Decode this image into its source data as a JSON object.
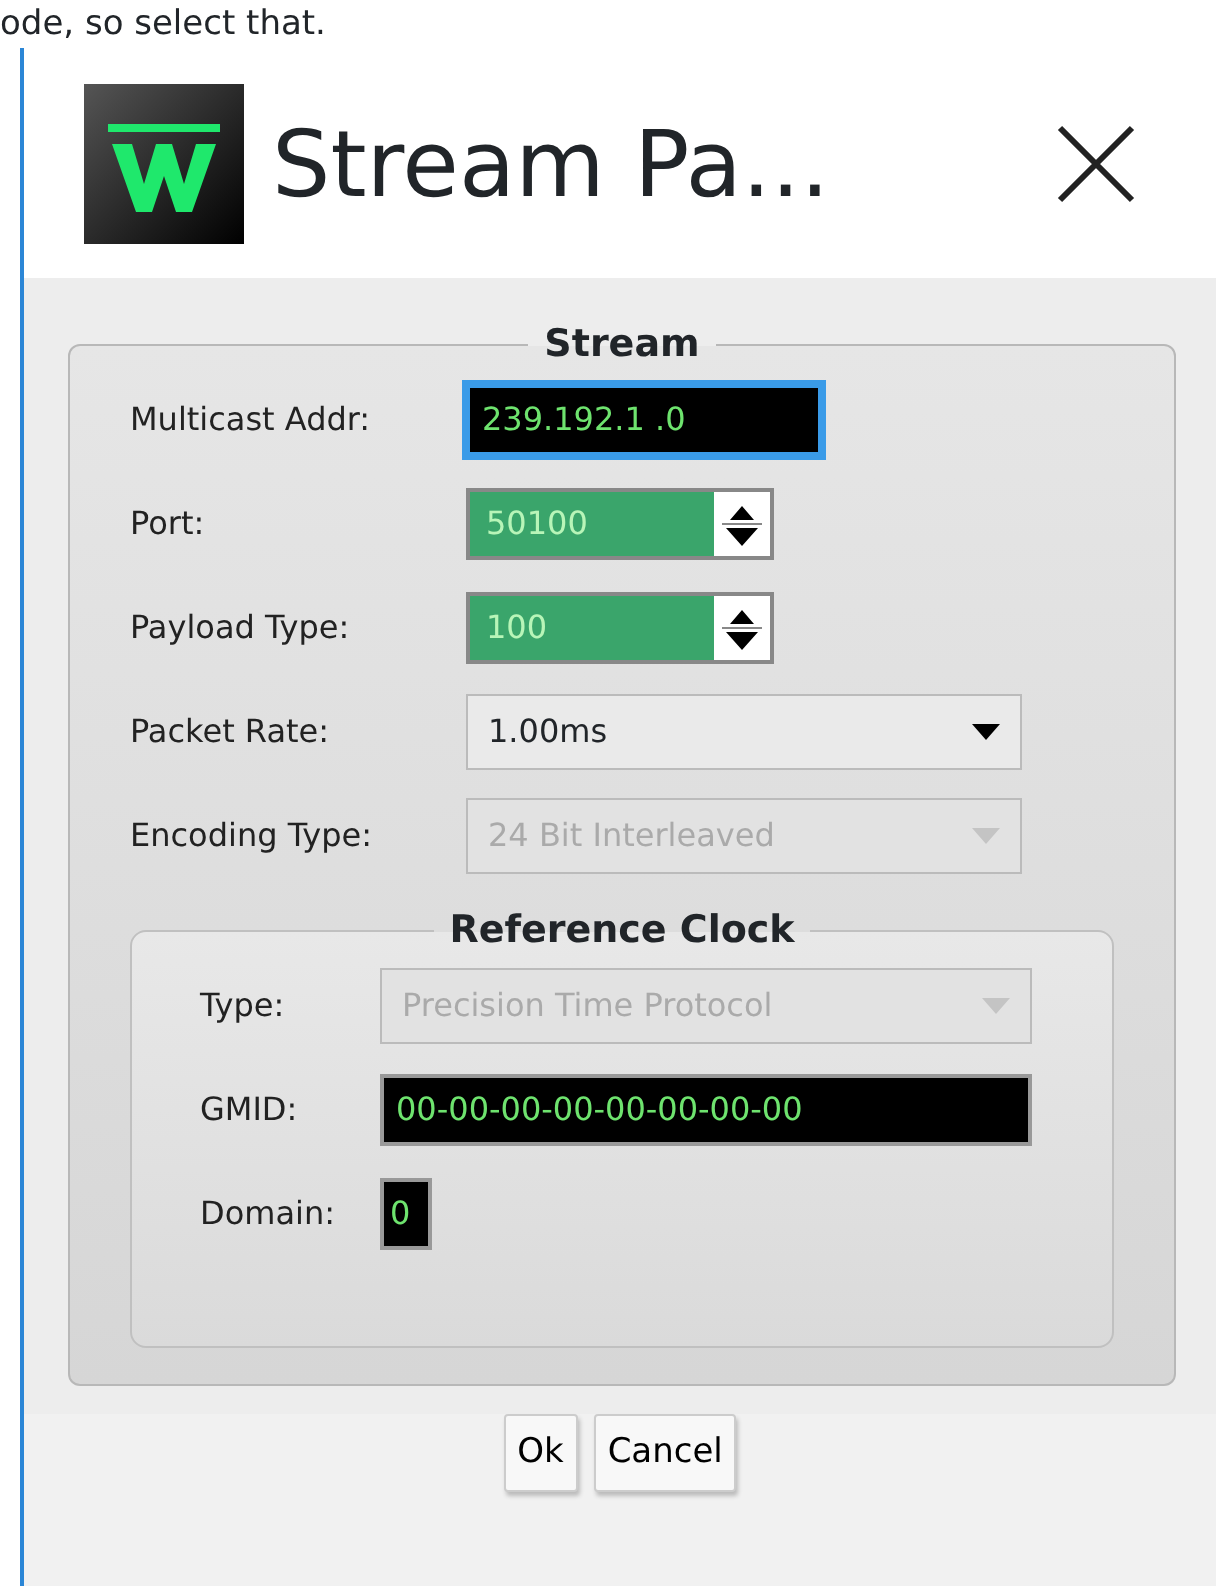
{
  "page_text": "ode, so select that.",
  "window": {
    "title": "Stream Pa..."
  },
  "stream": {
    "title": "Stream",
    "fields": [
      {
        "label": "Multicast Addr:",
        "kind": "text",
        "value": "239.192.1  .0",
        "focused": true,
        "disabled": false
      },
      {
        "label": "Port:",
        "kind": "spinner",
        "value": "50100",
        "focused": false,
        "disabled": false
      },
      {
        "label": "Payload Type:",
        "kind": "spinner",
        "value": "100",
        "focused": false,
        "disabled": false
      },
      {
        "label": "Packet Rate:",
        "kind": "select",
        "value": "1.00ms",
        "focused": false,
        "disabled": false
      },
      {
        "label": "Encoding Type:",
        "kind": "select",
        "value": "24 Bit Interleaved",
        "focused": false,
        "disabled": true
      }
    ]
  },
  "reference_clock": {
    "title": "Reference Clock",
    "fields": [
      {
        "label": "Type:",
        "kind": "select",
        "value": "Precision Time Protocol",
        "focused": false,
        "disabled": true
      },
      {
        "label": "GMID:",
        "kind": "text",
        "value": "00-00-00-00-00-00-00-00",
        "focused": false,
        "disabled": false
      },
      {
        "label": "Domain:",
        "kind": "short",
        "value": "0",
        "focused": false,
        "disabled": false
      }
    ]
  },
  "buttons": [
    "Ok",
    "Cancel"
  ]
}
